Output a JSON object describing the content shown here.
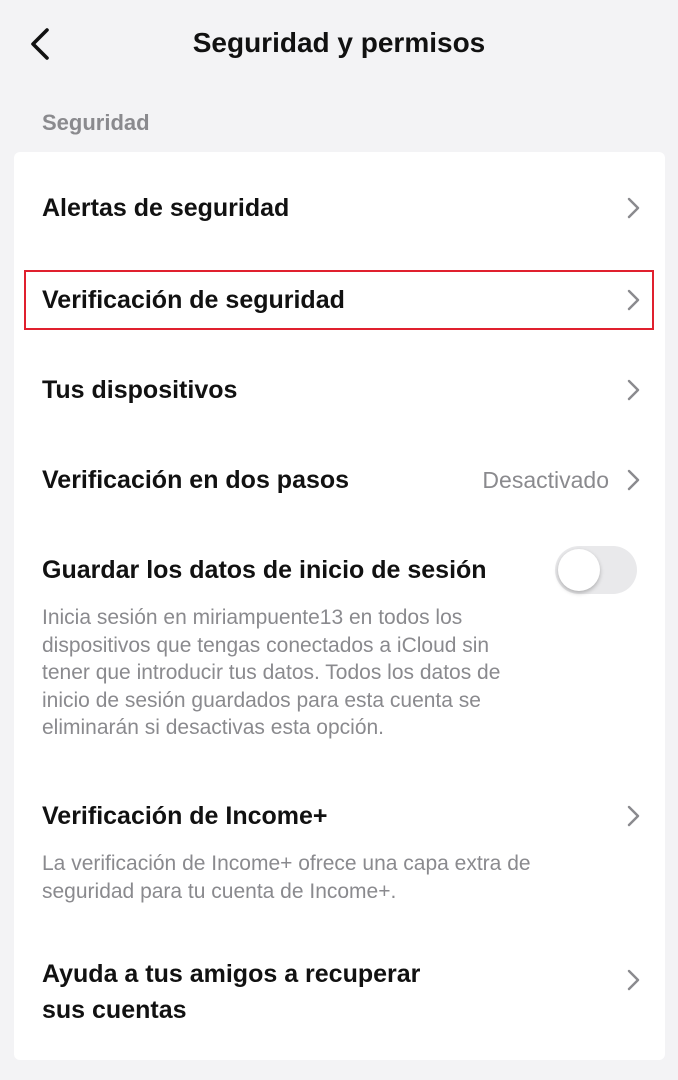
{
  "header": {
    "title": "Seguridad y permisos"
  },
  "section": {
    "label": "Seguridad"
  },
  "items": [
    {
      "label": "Alertas de seguridad"
    },
    {
      "label": "Verificación de seguridad"
    },
    {
      "label": "Tus dispositivos"
    },
    {
      "label": "Verificación en dos pasos",
      "value": "Desactivado"
    },
    {
      "label": "Guardar los datos de inicio de sesión",
      "toggle_on": false,
      "desc_lines": [
        "Inicia sesión en miriampuente13 en todos los",
        "dispositivos que tengas conectados a iCloud sin",
        "tener que introducir tus datos. Todos los datos de",
        "inicio de sesión guardados para esta cuenta se",
        "eliminarán si desactivas esta opción."
      ]
    },
    {
      "label": "Verificación de Income+",
      "desc_lines": [
        "La verificación de Income+ ofrece una capa extra de",
        "seguridad para tu cuenta de Income+."
      ]
    },
    {
      "label_lines": [
        "Ayuda a tus amigos a recuperar",
        "sus cuentas"
      ]
    }
  ],
  "colors": {
    "background": "#f3f3f5",
    "card": "#ffffff",
    "highlight": "#e0202e",
    "secondary_text": "#8a8a8e"
  }
}
